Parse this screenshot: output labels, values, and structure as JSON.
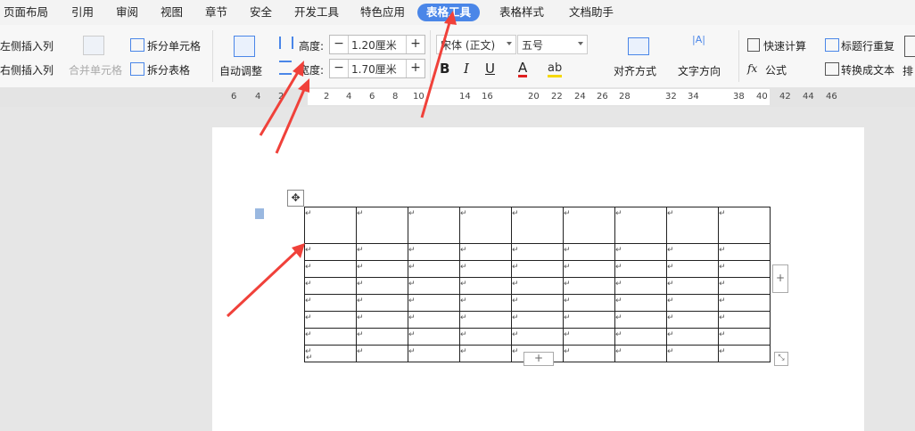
{
  "tabs": [
    {
      "label": "页面布局",
      "active": false
    },
    {
      "label": "引用",
      "active": false
    },
    {
      "label": "审阅",
      "active": false
    },
    {
      "label": "视图",
      "active": false
    },
    {
      "label": "章节",
      "active": false
    },
    {
      "label": "安全",
      "active": false
    },
    {
      "label": "开发工具",
      "active": false
    },
    {
      "label": "特色应用",
      "active": false
    },
    {
      "label": "表格工具",
      "active": true
    },
    {
      "label": "表格样式",
      "active": false
    },
    {
      "label": "文档助手",
      "active": false
    }
  ],
  "ribbon": {
    "insert_left": "左侧插入列",
    "insert_right": "右侧插入列",
    "merge_cells": "合并单元格",
    "split_cells": "拆分单元格",
    "split_table": "拆分表格",
    "auto_fit": "自动调整",
    "height_label": "高度:",
    "height_value": "1.20厘米",
    "width_label": "宽度:",
    "width_value": "1.70厘米",
    "font_name": "宋体 (正文)",
    "font_size": "五号",
    "bold": "B",
    "italic": "I",
    "underline": "U",
    "font_color": "A",
    "align": "对齐方式",
    "text_direction": "文字方向",
    "quick_calc": "快速计算",
    "formula": "公式",
    "title_repeat": "标题行重复",
    "convert_text": "转换成文本",
    "more": "排"
  },
  "ruler": {
    "numbers": [
      "6",
      "4",
      "2",
      "2",
      "4",
      "6",
      "8",
      "10",
      "14",
      "16",
      "20",
      "22",
      "24",
      "26",
      "28",
      "32",
      "34",
      "38",
      "40",
      "42",
      "44",
      "46"
    ]
  },
  "table": {
    "rows": 8,
    "cols": 9,
    "cell_mark": "↵",
    "first_row_tall": true
  },
  "colors": {
    "accent": "#4a86e8",
    "arrow": "#f0413a"
  }
}
